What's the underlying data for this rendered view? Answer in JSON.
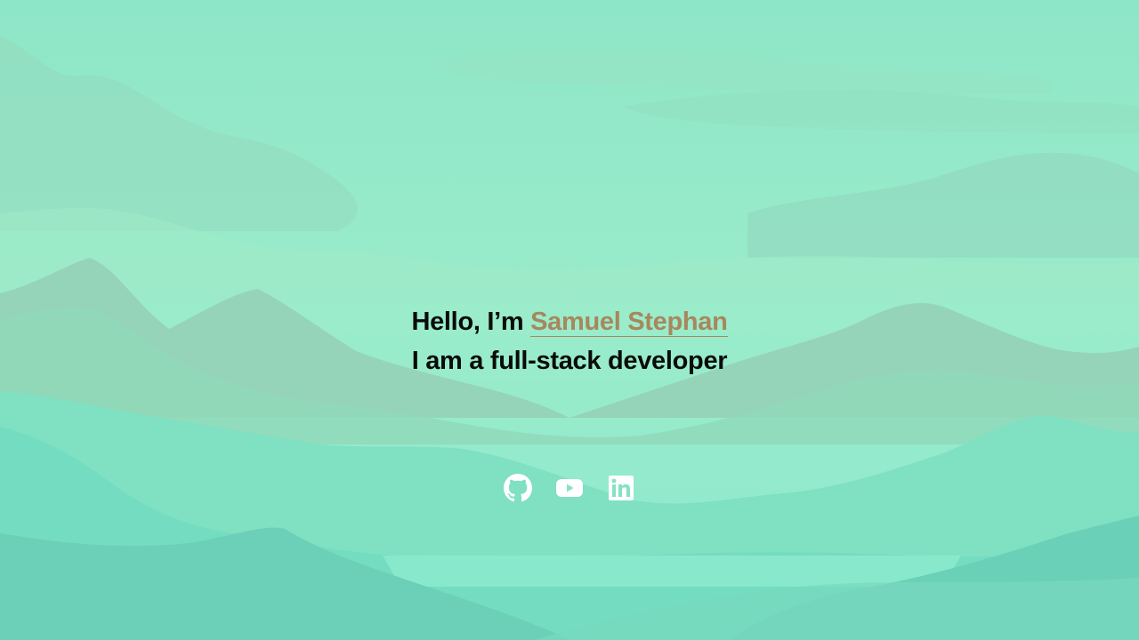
{
  "hero": {
    "greeting": "Hello, I’m ",
    "name": "Samuel Stephan",
    "tagline": "I am a full-stack developer"
  },
  "socials": [
    {
      "icon": "github-icon"
    },
    {
      "icon": "youtube-icon"
    },
    {
      "icon": "linkedin-icon"
    }
  ],
  "colors": {
    "accent": "#a8875d",
    "text": "#0b0b0b",
    "background": "#8fe4c6",
    "icon": "#ffffff"
  }
}
